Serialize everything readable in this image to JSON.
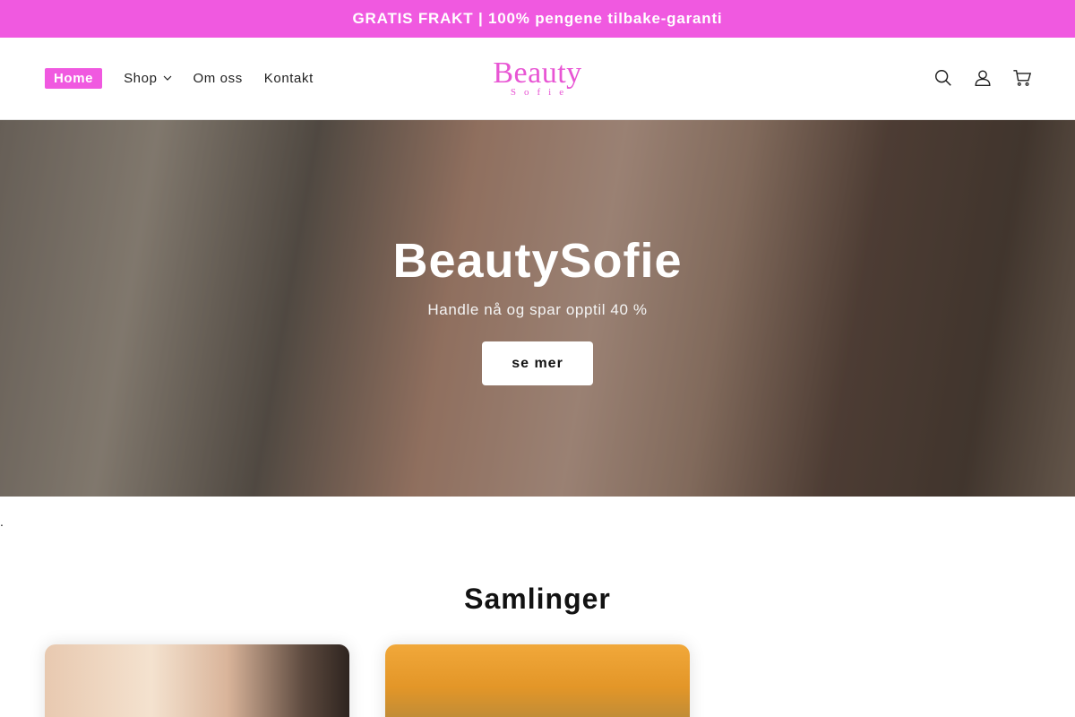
{
  "announcement": {
    "text": "GRATIS FRAKT | 100% pengene tilbake-garanti"
  },
  "nav": {
    "items": [
      {
        "label": "Home",
        "active": true
      },
      {
        "label": "Shop",
        "has_dropdown": true
      },
      {
        "label": "Om oss"
      },
      {
        "label": "Kontakt"
      }
    ]
  },
  "logo": {
    "main": "Beauty",
    "sub": "Sofie"
  },
  "header_icons": [
    "search-icon",
    "account-icon",
    "cart-icon"
  ],
  "hero": {
    "title": "BeautySofie",
    "subtitle": "Handle nå og spar opptil 40 %",
    "button_label": "se mer"
  },
  "stray_text": ".",
  "collections": {
    "title": "Samlinger",
    "cards": [
      {
        "image": "woman-sunlight-image"
      },
      {
        "image": "golden-field-image"
      }
    ]
  },
  "colors": {
    "accent": "#f059e0",
    "logo": "#e855d4"
  }
}
